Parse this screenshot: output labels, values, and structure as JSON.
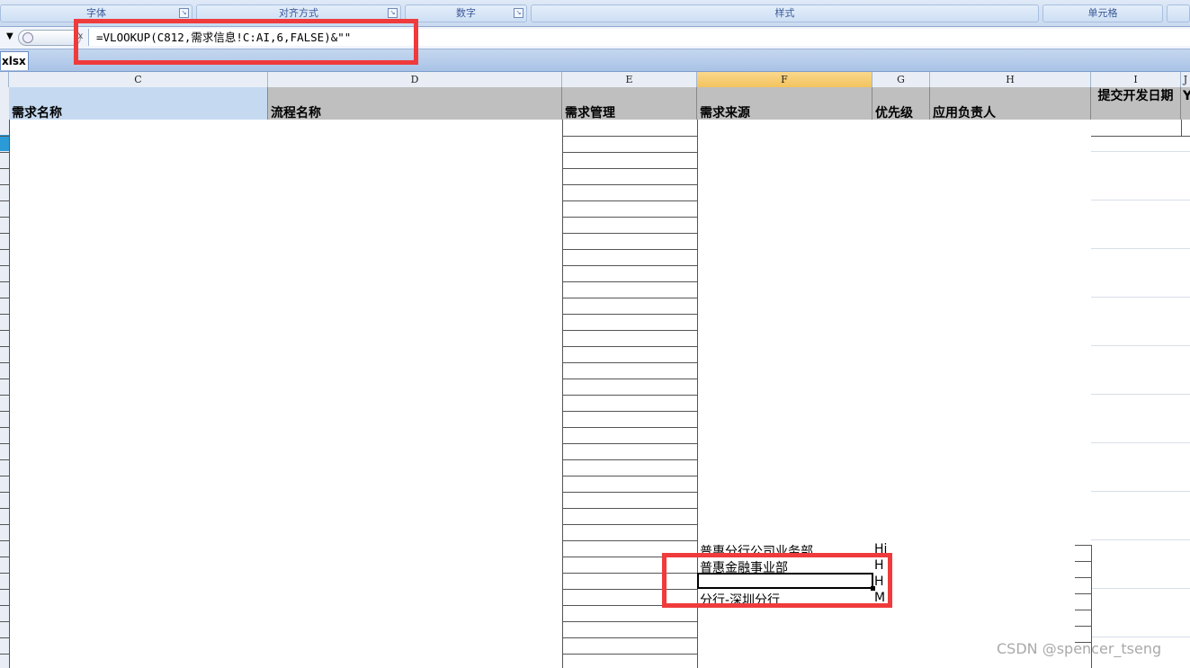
{
  "ribbon": {
    "groups": [
      {
        "label": "字体"
      },
      {
        "label": "对齐方式"
      },
      {
        "label": "数字"
      },
      {
        "label": "样式"
      },
      {
        "label": "单元格"
      }
    ]
  },
  "formula_bar": {
    "formula": "=VLOOKUP(C812,需求信息!C:AI,6,FALSE)&\"\""
  },
  "workbook_tab": {
    "label": "xlsx"
  },
  "columns": [
    {
      "letter": "C"
    },
    {
      "letter": "D"
    },
    {
      "letter": "E"
    },
    {
      "letter": "F"
    },
    {
      "letter": "G"
    },
    {
      "letter": "H"
    },
    {
      "letter": "I"
    },
    {
      "letter": "J"
    }
  ],
  "header_row": {
    "c": "需求名称",
    "d": "流程名称",
    "e": "需求管理",
    "f": "需求来源",
    "g": "优先级",
    "h": "应用负责人",
    "i": "提交开发日期",
    "j": "Y"
  },
  "cells": {
    "f_row_a": "普惠分行公司业务部",
    "f_row_b": "普惠金融事业部",
    "f_row_c": "",
    "f_row_d": "分行-深圳分行",
    "g_row_a": "Hi",
    "g_row_b": "H",
    "g_row_c": "H",
    "g_row_d": "M"
  },
  "watermark": "CSDN @spencer_tseng"
}
